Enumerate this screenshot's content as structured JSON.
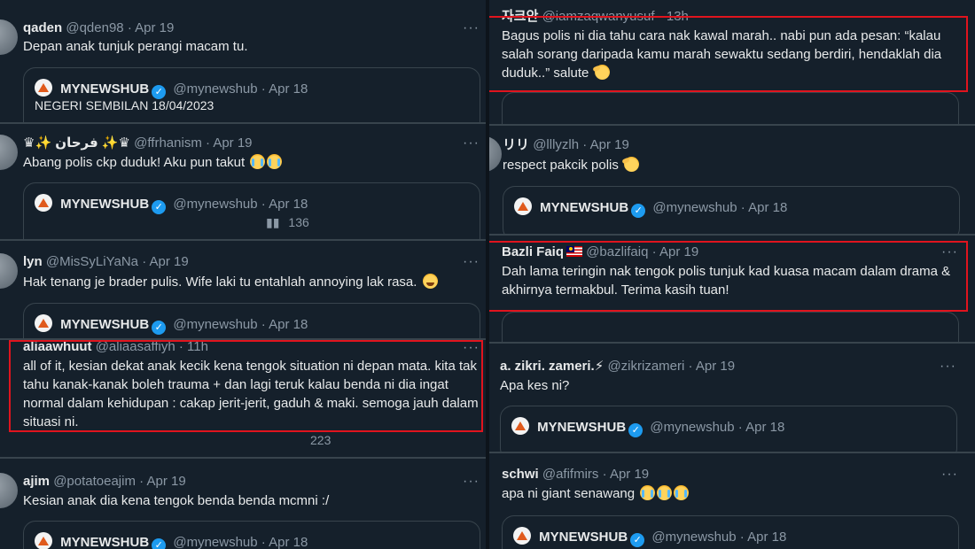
{
  "left": {
    "tweets": [
      {
        "name": "qaden",
        "handle": "@qden98",
        "date": "Apr 19",
        "text": "Depan anak tunjuk perangi macam tu.",
        "quote": {
          "name": "MYNEWSHUB",
          "handle": "@mynewshub",
          "date": "Apr 18",
          "text": "NEGERI SEMBILAN 18/04/2023"
        }
      },
      {
        "name": "♛✨ فرحان ✨♛",
        "handle": "@ffrhanism",
        "date": "Apr 19",
        "text": "Abang polis ckp duduk! Aku pun takut",
        "emoji": "loudly-crying-face",
        "quote": {
          "name": "MYNEWSHUB",
          "handle": "@mynewshub",
          "date": "Apr 18"
        },
        "views": "136"
      },
      {
        "name": "lyn",
        "handle": "@MisSyLiYaNa",
        "date": "Apr 19",
        "text": "Hak tenang je brader pulis. Wife laki tu entahlah annoying lak rasa.",
        "emoji": "tears-of-joy-face",
        "quote": {
          "name": "MYNEWSHUB",
          "handle": "@mynewshub",
          "date": "Apr 18"
        }
      },
      {
        "name": "aliaawhuut",
        "handle": "@aliaasaffiyh",
        "date": "11h",
        "text": "all of it, kesian dekat anak kecik kena tengok situation ni depan mata. kita tak tahu kanak-kanak boleh trauma + dan lagi teruk kalau benda ni dia ingat normal dalam kehidupan : cakap jerit-jerit, gaduh & maki. semoga jauh dalam situasi ni.",
        "views": "223"
      },
      {
        "name": "ajim",
        "handle": "@potatoeajim",
        "date": "Apr 19",
        "text": "Kesian anak dia kena tengok benda benda mcmni :/",
        "quote": {
          "name": "MYNEWSHUB",
          "handle": "@mynewshub",
          "date": "Apr 18"
        }
      }
    ]
  },
  "right": {
    "tweets": [
      {
        "name": "자크안",
        "handle": "@iamzaqwanyusuf",
        "date": "13h",
        "text": "Bagus polis ni dia tahu cara nak kawal marah.. nabi pun ada pesan: “kalau salah sorang daripada kamu marah sewaktu sedang berdiri, hendaklah dia duduk..” salute",
        "emoji": "saluting-face"
      },
      {
        "name": "リリ",
        "handle": "@lllyzlh",
        "date": "Apr 19",
        "text": "respect pakcik polis",
        "emoji": "saluting-face",
        "quote": {
          "name": "MYNEWSHUB",
          "handle": "@mynewshub",
          "date": "Apr 18"
        }
      },
      {
        "name": "Bazli Faiq",
        "flag": "malaysia-flag",
        "handle": "@bazlifaiq",
        "date": "Apr 19",
        "text": "Dah lama teringin nak tengok polis tunjuk kad kuasa macam dalam drama & akhirnya termakbul. Terima kasih tuan!"
      },
      {
        "name": "a. zikri. zameri.⚡",
        "handle": "@zikrizameri",
        "date": "Apr 19",
        "text": "Apa kes ni?",
        "quote": {
          "name": "MYNEWSHUB",
          "handle": "@mynewshub",
          "date": "Apr 18"
        }
      },
      {
        "name": "schwi",
        "handle": "@afifmirs",
        "date": "Apr 19",
        "text": "apa ni giant senawang",
        "emoji": "loudly-crying-face ×3",
        "quote": {
          "name": "MYNEWSHUB",
          "handle": "@mynewshub",
          "date": "Apr 18"
        }
      }
    ]
  },
  "ui": {
    "more": "···",
    "dot": "·",
    "verified": "✓"
  },
  "colors": {
    "background": "#15202b",
    "border": "#38444d",
    "muted": "#8b98a5",
    "verified": "#1d9bf0",
    "highlight": "#e0141e"
  }
}
